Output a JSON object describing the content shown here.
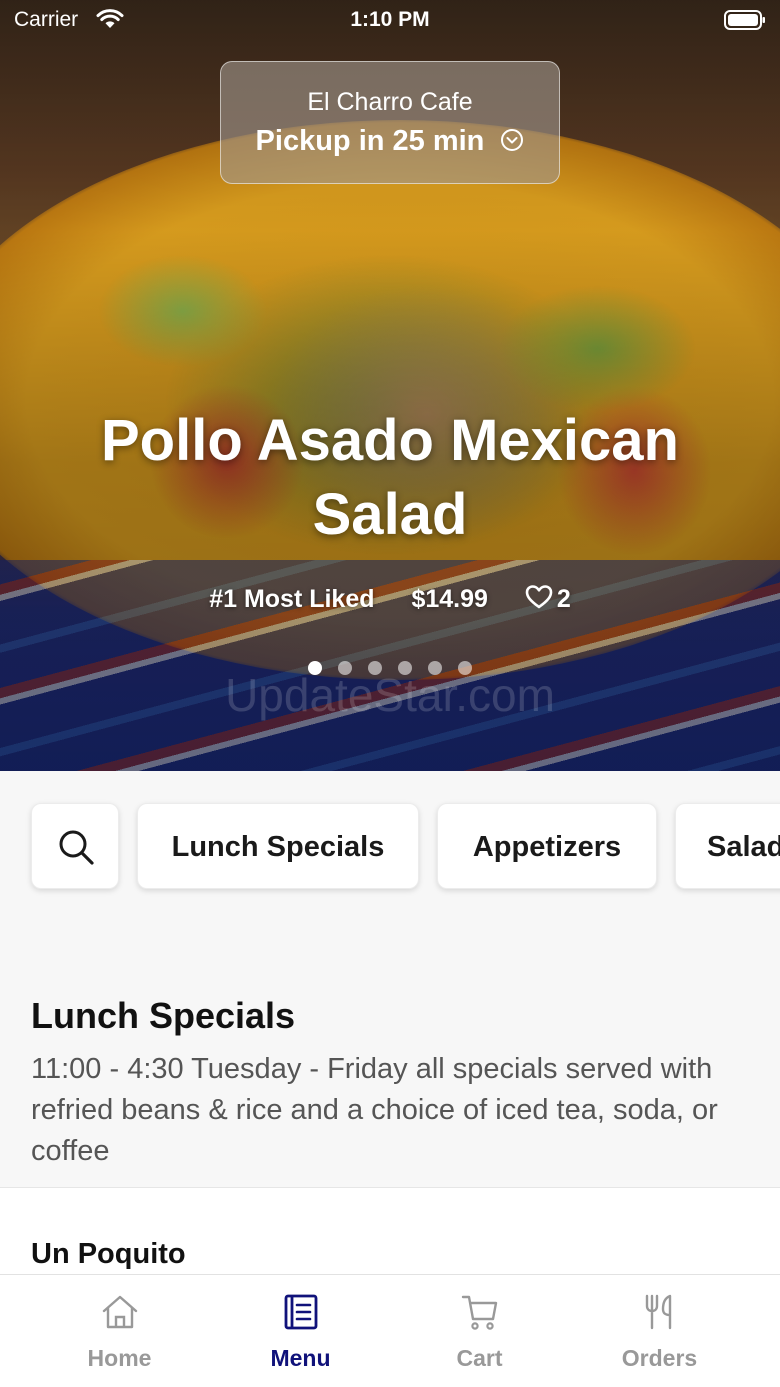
{
  "status_bar": {
    "carrier": "Carrier",
    "time": "1:10 PM"
  },
  "location": {
    "restaurant": "El Charro Cafe",
    "pickup": "Pickup in 25 min"
  },
  "hero": {
    "title": "Pollo Asado Mexican Salad",
    "rank": "#1 Most Liked",
    "price": "$14.99",
    "likes": "2",
    "page_count": 6,
    "active_page": 1,
    "watermark": "UpdateStar.com"
  },
  "categories": {
    "items": [
      {
        "label": "Lunch Specials"
      },
      {
        "label": "Appetizers"
      },
      {
        "label": "Salads"
      }
    ]
  },
  "section": {
    "title": "Lunch Specials",
    "description": "11:00 - 4:30 Tuesday - Friday all specials served with refried beans & rice and a choice of iced tea, soda, or coffee"
  },
  "menu_items": [
    {
      "name": "Un Poquito"
    }
  ],
  "tabs": {
    "home": "Home",
    "menu": "Menu",
    "cart": "Cart",
    "orders": "Orders",
    "active": "menu"
  },
  "colors": {
    "accent": "#10127a",
    "inactive_tab": "#999999"
  }
}
